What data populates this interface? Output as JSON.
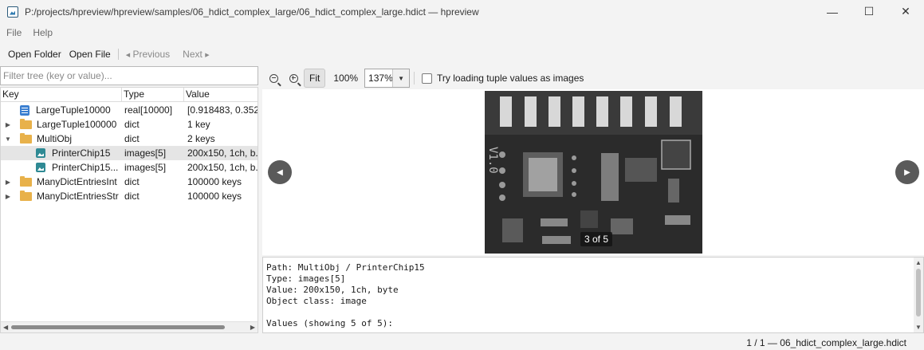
{
  "window": {
    "title": "P:/projects/hpreview/hpreview/samples/06_hdict_complex_large/06_hdict_complex_large.hdict — hpreview",
    "minimize": "—",
    "maximize": "☐",
    "close": "✕"
  },
  "menu": {
    "file": "File",
    "help": "Help"
  },
  "toolbar": {
    "open_folder": "Open Folder",
    "open_file": "Open File",
    "previous": "Previous",
    "next": "Next"
  },
  "filter": {
    "placeholder": "Filter tree (key or value)..."
  },
  "tree": {
    "headers": {
      "key": "Key",
      "type": "Type",
      "value": "Value"
    },
    "rows": [
      {
        "key": "LargeTuple10000",
        "type": "real[10000]",
        "value": "[0.918483, 0.352...",
        "icon": "list-icon",
        "expander": "",
        "selected": false
      },
      {
        "key": "LargeTuple100000",
        "type": "dict",
        "value": "1 key",
        "icon": "folder-icon",
        "expander": "▶",
        "selected": false
      },
      {
        "key": "MultiObj",
        "type": "dict",
        "value": "2 keys",
        "icon": "folder-icon",
        "expander": "▼",
        "selected": false
      },
      {
        "key": "PrinterChip15",
        "type": "images[5]",
        "value": "200x150, 1ch, b...",
        "icon": "image-icon",
        "expander": "",
        "selected": true
      },
      {
        "key": "PrinterChip15...",
        "type": "images[5]",
        "value": "200x150, 1ch, b...",
        "icon": "image-icon",
        "expander": "",
        "selected": false
      },
      {
        "key": "ManyDictEntriesInt",
        "type": "dict",
        "value": "100000 keys",
        "icon": "folder-icon",
        "expander": "▶",
        "selected": false
      },
      {
        "key": "ManyDictEntriesStr",
        "type": "dict",
        "value": "100000 keys",
        "icon": "folder-icon",
        "expander": "▶",
        "selected": false
      }
    ]
  },
  "viewer": {
    "fit": "Fit",
    "zoom_100": "100%",
    "zoom_value": "137%",
    "tuple_checkbox_label": "Try loading tuple values as images",
    "tuple_checkbox_checked": false,
    "counter": "3 of 5",
    "prev_glyph": "◀",
    "next_glyph": "▶"
  },
  "details": {
    "text": "Path: MultiObj / PrinterChip15\nType: images[5]\nValue: 200x150, 1ch, byte\nObject class: image\n\nValues (showing 5 of 5):"
  },
  "status": {
    "text": "1 / 1 — 06_hdict_complex_large.hdict"
  }
}
